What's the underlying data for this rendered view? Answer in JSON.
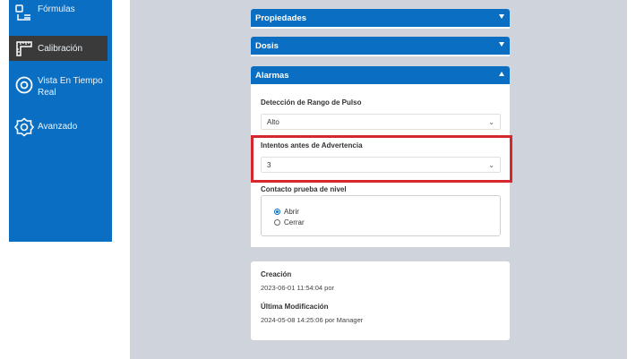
{
  "sidebar": {
    "items": [
      {
        "label": "Fórmulas",
        "icon": "formulas-icon"
      },
      {
        "label": "Calibración",
        "icon": "ruler-icon"
      },
      {
        "label": "Vista En Tiempo Real",
        "icon": "eye-icon"
      },
      {
        "label": "Avanzado",
        "icon": "gear-icon"
      }
    ]
  },
  "accordion": {
    "propiedades": {
      "title": "Propiedades"
    },
    "dosis": {
      "title": "Dosis"
    },
    "alarmas": {
      "title": "Alarmas",
      "pulse_range_label": "Detección de Rango de Pulso",
      "pulse_range_value": "Alto",
      "attempts_label": "Intentos antes de Advertencia",
      "attempts_value": "3",
      "level_contact_label": "Contacto prueba de nivel",
      "level_options": [
        {
          "label": "Abrir",
          "selected": true
        },
        {
          "label": "Cerrar",
          "selected": false
        }
      ]
    }
  },
  "info": {
    "created_label": "Creación",
    "created_value": "2023-06-01 11:54:04 por",
    "modified_label": "Última Modificación",
    "modified_value": "2024-05-08 14:25:06 por Manager"
  },
  "colors": {
    "primary": "#0a6fc2",
    "highlight": "#d6262e",
    "background": "#cfd4dc"
  }
}
